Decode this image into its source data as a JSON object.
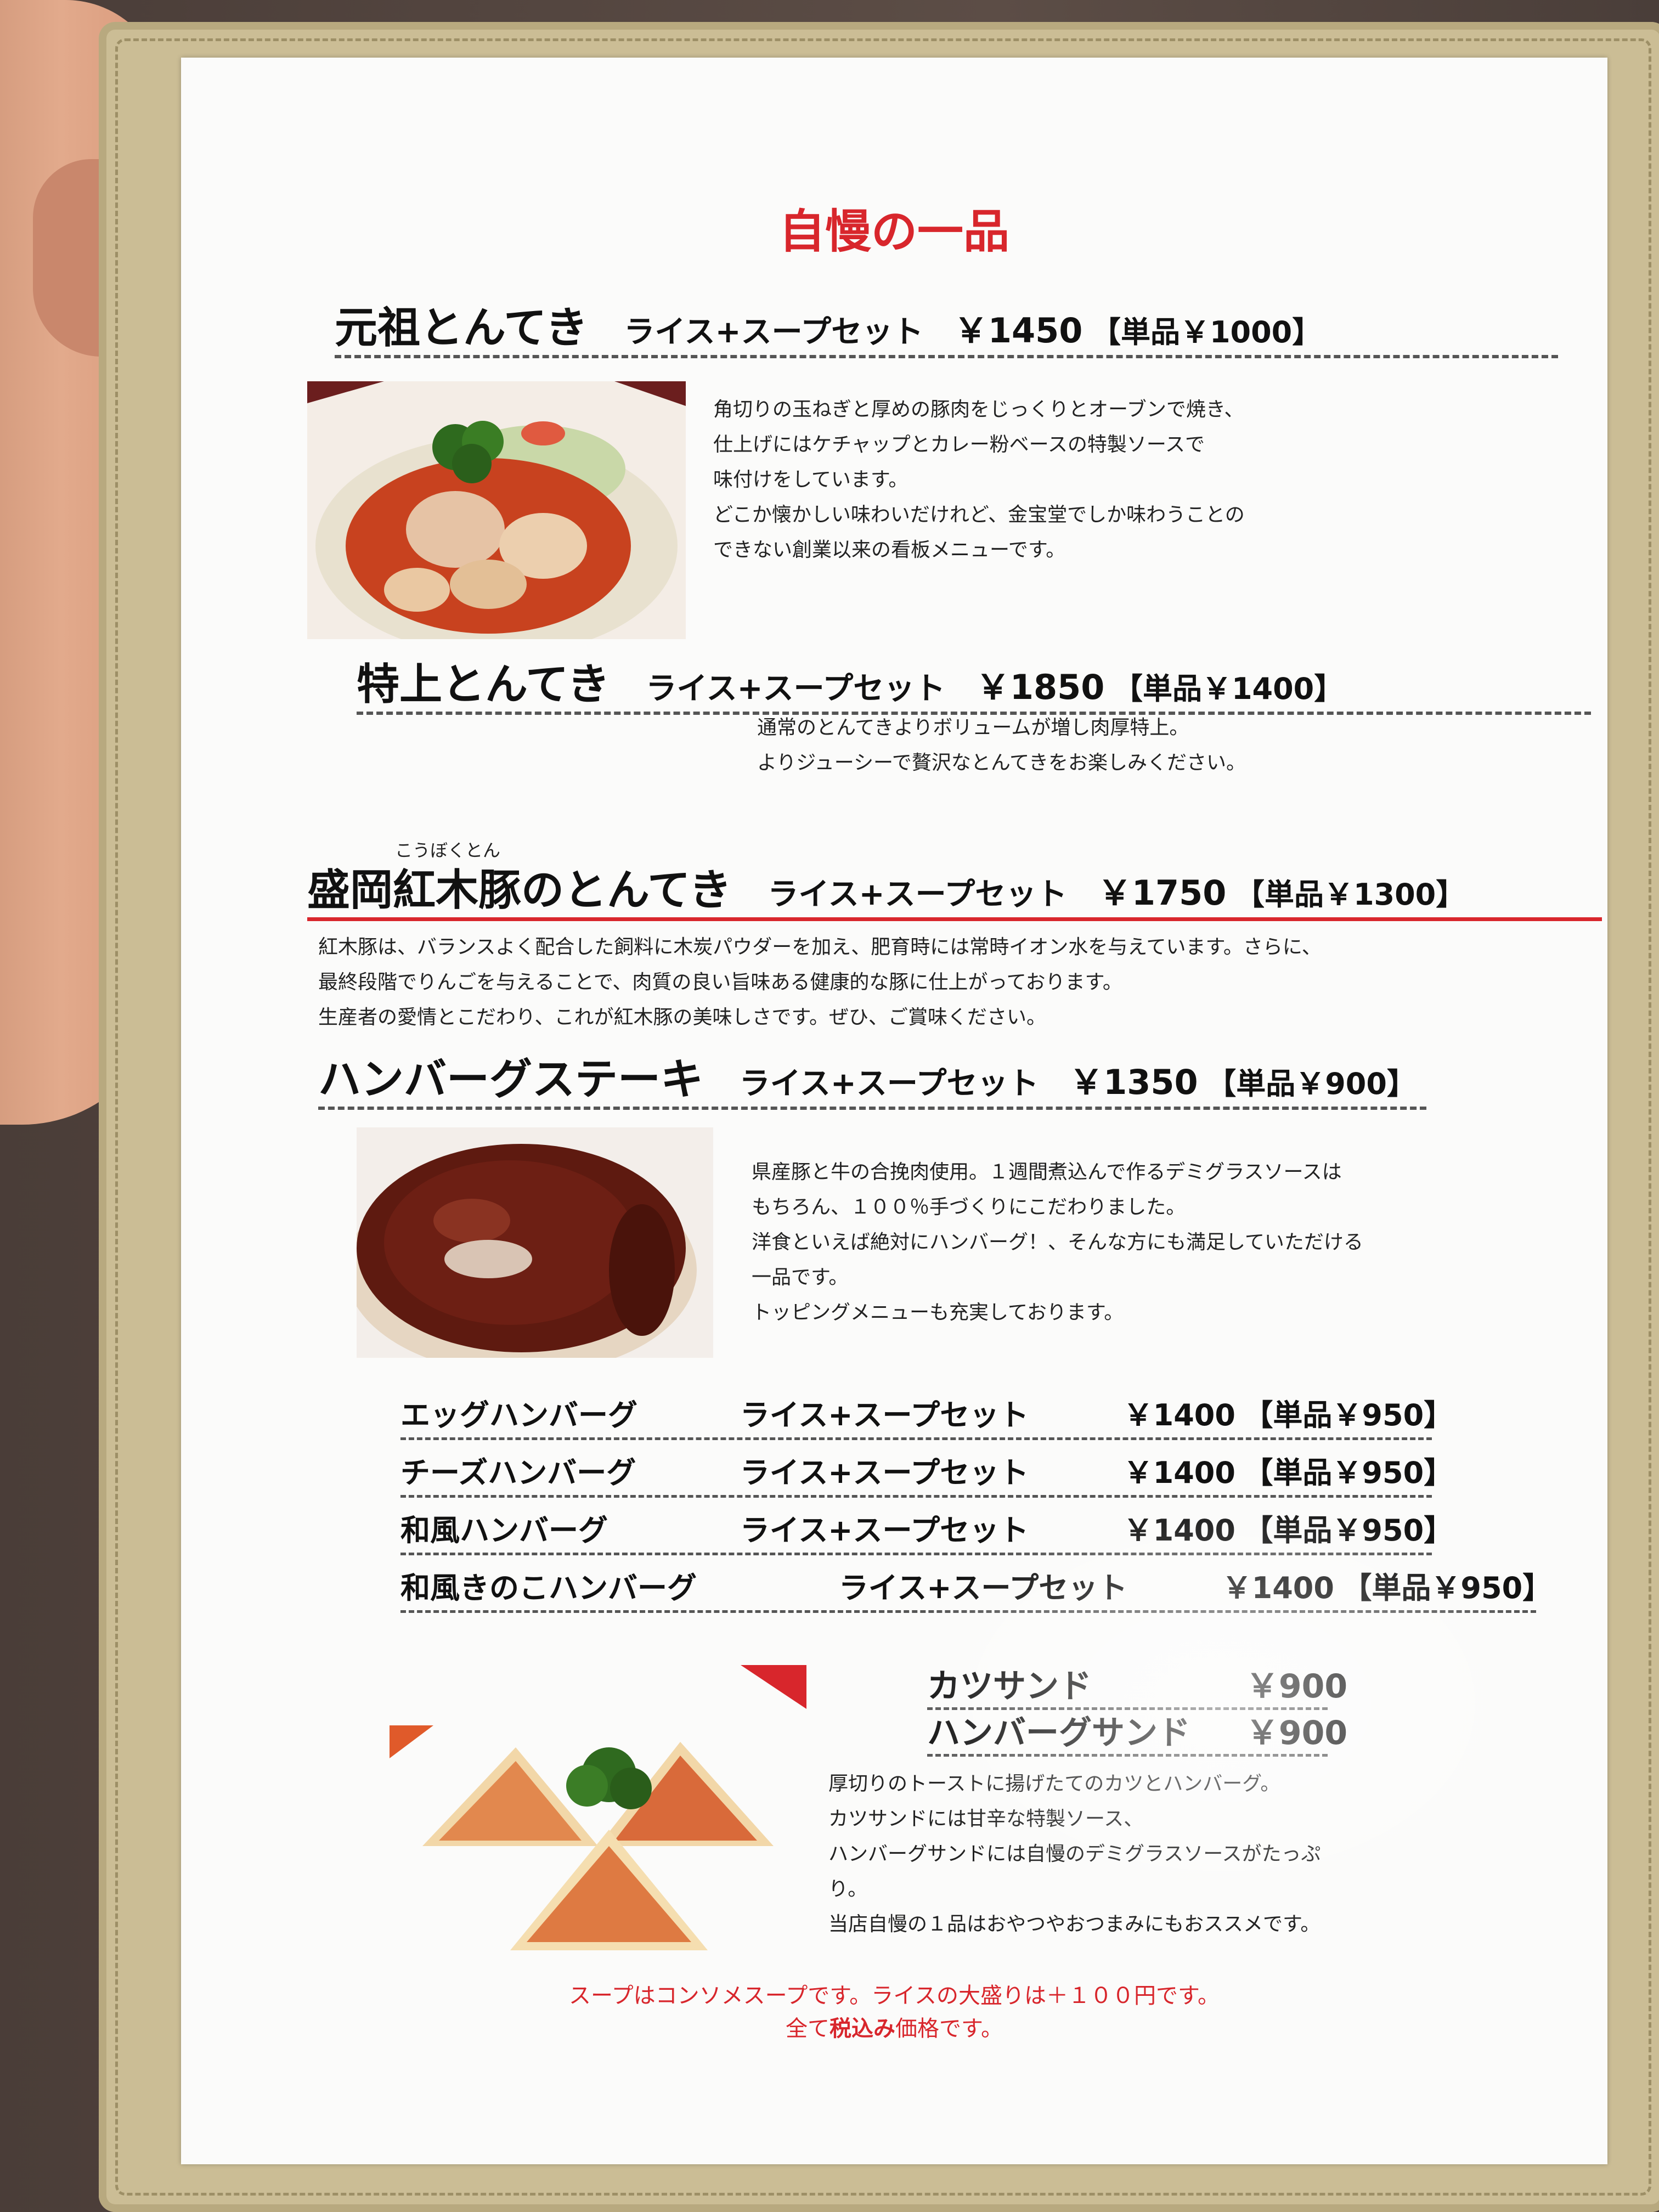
{
  "title": "自慢の一品",
  "items": [
    {
      "name": "元祖とんてき",
      "set": "ライス+スープセット",
      "price": "￥1450",
      "single": "【単品￥1000】",
      "desc": [
        "角切りの玉ねぎと厚めの豚肉をじっくりとオーブンで焼き、",
        "仕上げにはケチャップとカレー粉ベースの特製ソースで",
        "味付けをしています。",
        "どこか懐かしい味わいだけれど、金宝堂でしか味わうことの",
        "できない創業以来の看板メニューです。"
      ]
    },
    {
      "name": "特上とんてき",
      "set": "ライス+スープセット",
      "price": "￥1850",
      "single": "【単品￥1400】",
      "desc": [
        "通常のとんてきよりボリュームが増し肉厚特上。",
        "よりジューシーで贅沢なとんてきをお楽しみください。"
      ]
    },
    {
      "ruby": "こうぼくとん",
      "name": "盛岡紅木豚のとんてき",
      "set": "ライス+スープセット",
      "price": "￥1750",
      "single": "【単品￥1300】",
      "desc": [
        "紅木豚は、バランスよく配合した飼料に木炭パウダーを加え、肥育時には常時イオン水を与えています。さらに、",
        "最終段階でりんごを与えることで、肉質の良い旨味ある健康的な豚に仕上がっております。",
        "生産者の愛情とこだわり、これが紅木豚の美味しさです。ぜひ、ご賞味ください。"
      ]
    },
    {
      "name": "ハンバーグステーキ",
      "set": "ライス+スープセット",
      "price": "￥1350",
      "single": "【単品￥900】",
      "desc": [
        "県産豚と牛の合挽肉使用。１週間煮込んで作るデミグラスソースは",
        "もちろん、１００％手づくりにこだわりました。",
        "洋食といえば絶対にハンバーグ！、そんな方にも満足していただける",
        "一品です。",
        "トッピングメニューも充実しております。"
      ]
    }
  ],
  "hamburg_variants": [
    {
      "name": "エッグハンバーグ",
      "set": "ライス+スープセット",
      "price": "￥1400",
      "single": "【単品￥950】"
    },
    {
      "name": "チーズハンバーグ",
      "set": "ライス+スープセット",
      "price": "￥1400",
      "single": "【単品￥950】"
    },
    {
      "name": "和風ハンバーグ",
      "set": "ライス+スープセット",
      "price": "￥1400",
      "single": "【単品￥950】"
    },
    {
      "name": "和風きのこハンバーグ",
      "set": "ライス+スープセット",
      "price": "￥1400",
      "single": "【単品￥950】"
    }
  ],
  "sandwiches": [
    {
      "name": "カツサンド",
      "price": "￥900"
    },
    {
      "name": "ハンバーグサンド",
      "price": "￥900"
    }
  ],
  "sandwich_desc": [
    "厚切りのトーストに揚げたてのカツとハンバーグ。",
    "カツサンドには甘辛な特製ソース、",
    "ハンバーグサンドには自慢のデミグラスソースがたっぷ",
    "り。",
    "当店自慢の１品はおやつやおつまみにもおススメです。"
  ],
  "footnote_1": "スープはコンソメスープです。ライスの大盛りは＋１００円です。",
  "footnote_2_pre": "全て",
  "footnote_2_bold": "税込み",
  "footnote_2_post": "価格です。"
}
